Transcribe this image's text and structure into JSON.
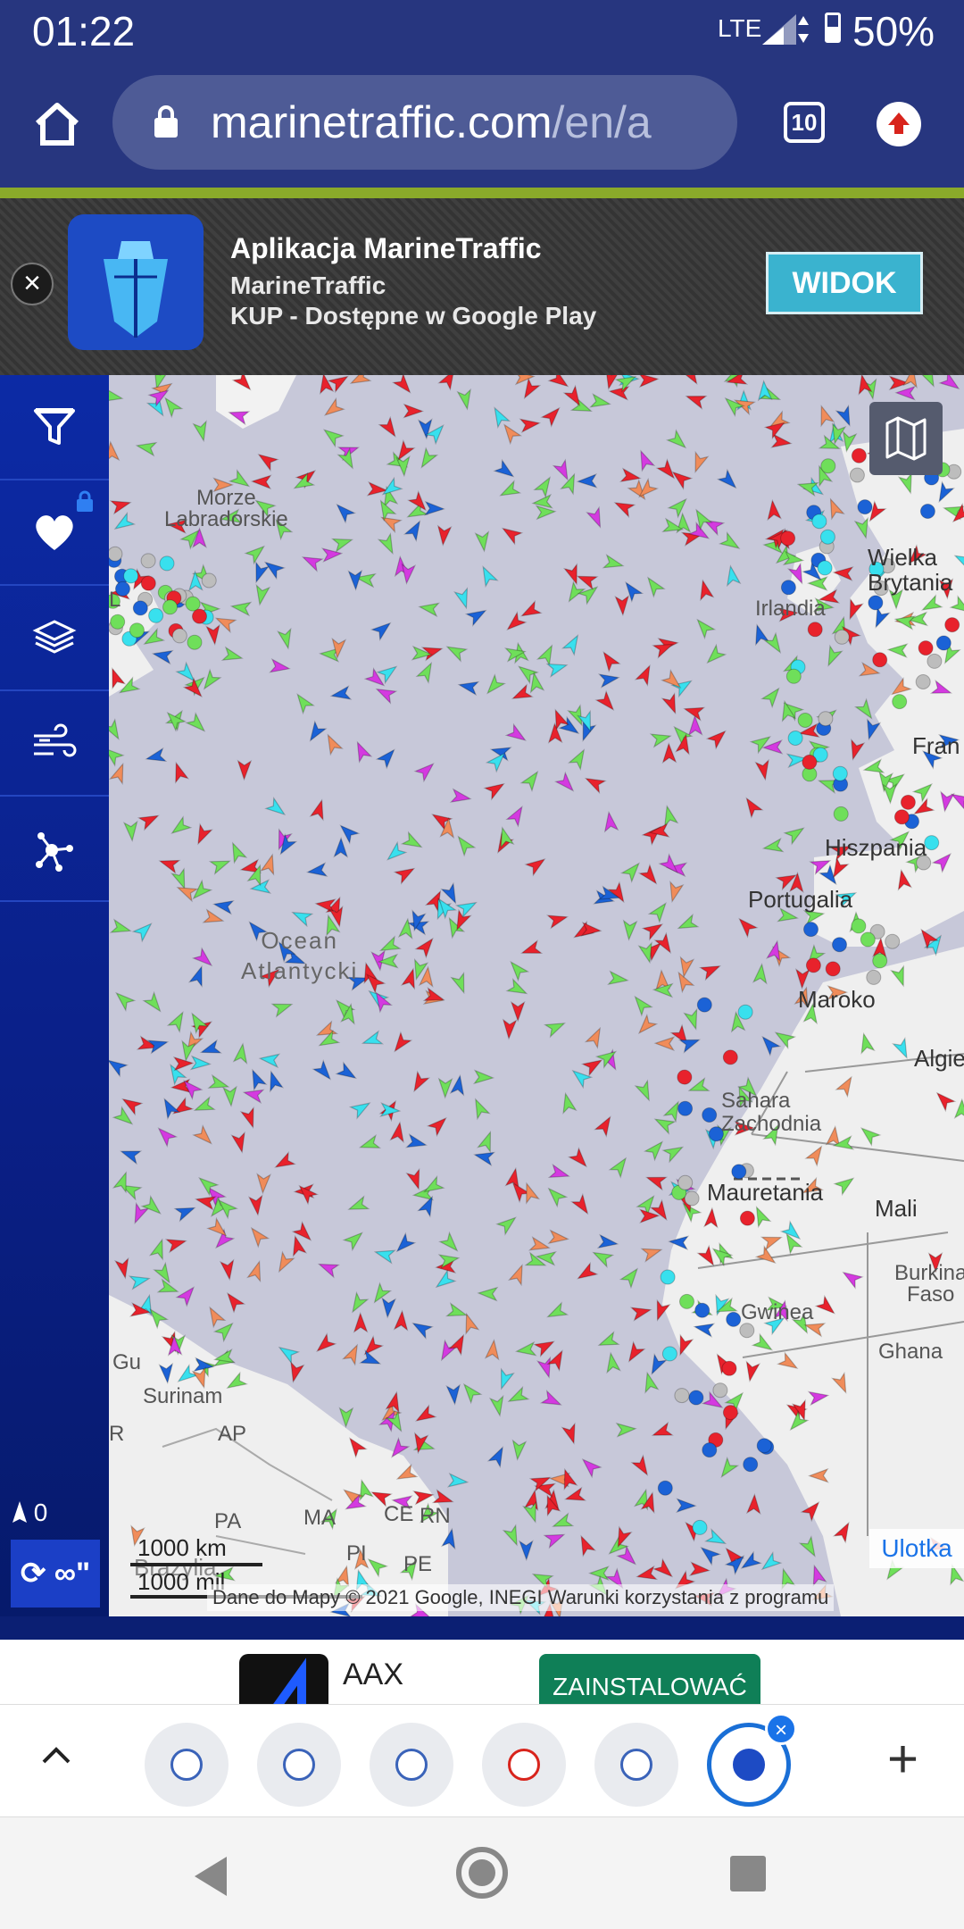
{
  "status_bar": {
    "time": "01:22",
    "network": "LTE",
    "battery": "50%"
  },
  "browser": {
    "url_host": "marinetraffic.com",
    "url_path": "/en/a",
    "tab_count": "10"
  },
  "app_banner": {
    "title": "Aplikacja MarineTraffic",
    "publisher": "MarineTraffic",
    "cta_line": "KUP - Dostępne w Google Play",
    "button_label": "WIDOK",
    "close_symbol": "×"
  },
  "sidebar": {
    "items": [
      {
        "name": "filter-icon"
      },
      {
        "name": "heart-icon",
        "locked": true
      },
      {
        "name": "layers-icon"
      },
      {
        "name": "wind-icon"
      },
      {
        "name": "network-icon"
      }
    ],
    "vessel_count": "0",
    "refresh_label": "∞\""
  },
  "map": {
    "labels": {
      "labrador_1": "Morze",
      "labrador_2": "Labradorskie",
      "ocean_1": "Ocean",
      "ocean_2": "Atlantycki",
      "britain_1": "Wielka",
      "britain_2": "Brytania",
      "ireland": "Irlandia",
      "france": "Fran",
      "spain": "Hiszpania",
      "portugal": "Portugalia",
      "morocco": "Maroko",
      "algeria": "Algie",
      "sahara_1": "Sahara",
      "sahara_2": "Zachodnia",
      "mauritania": "Mauretania",
      "mali": "Mali",
      "burkina_1": "Burkina",
      "burkina_2": "Faso",
      "guinea": "Gwinea",
      "ghana": "Ghana",
      "guyana": "Gu",
      "suriname": "Surinam",
      "amapa": "AP",
      "para": "PA",
      "maranhao": "MA",
      "ceara": "CE",
      "rn": "RN",
      "piaui": "PI",
      "pernambuco": "PE",
      "brazil": "Brazylia",
      "roraima": "R",
      "labrador_coast": "L"
    },
    "scale_km": "1000 km",
    "scale_mi": "1000 mil",
    "attribution": "Dane do Mapy © 2021 Google, INEGI   Warunki korzystania z programu",
    "legend_button": "Ulotka",
    "vessel_colors": {
      "cargo": "#6fdf5a",
      "tanker": "#e8222c",
      "passenger": "#1b62d6",
      "fishing": "#f08c5a",
      "pleasure": "#d43ae0",
      "tug": "#38e0ee",
      "unknown": "#bdbdbd"
    }
  },
  "bottom_ad": {
    "app_name": "AAX",
    "install_label": "ZAINSTALOWAĆ"
  },
  "tab_strip": {
    "tabs": [
      {
        "name": "tab-1"
      },
      {
        "name": "tab-2"
      },
      {
        "name": "tab-3"
      },
      {
        "name": "tab-4"
      },
      {
        "name": "tab-5"
      },
      {
        "name": "tab-marinetraffic",
        "active": true
      }
    ],
    "add_symbol": "+"
  }
}
